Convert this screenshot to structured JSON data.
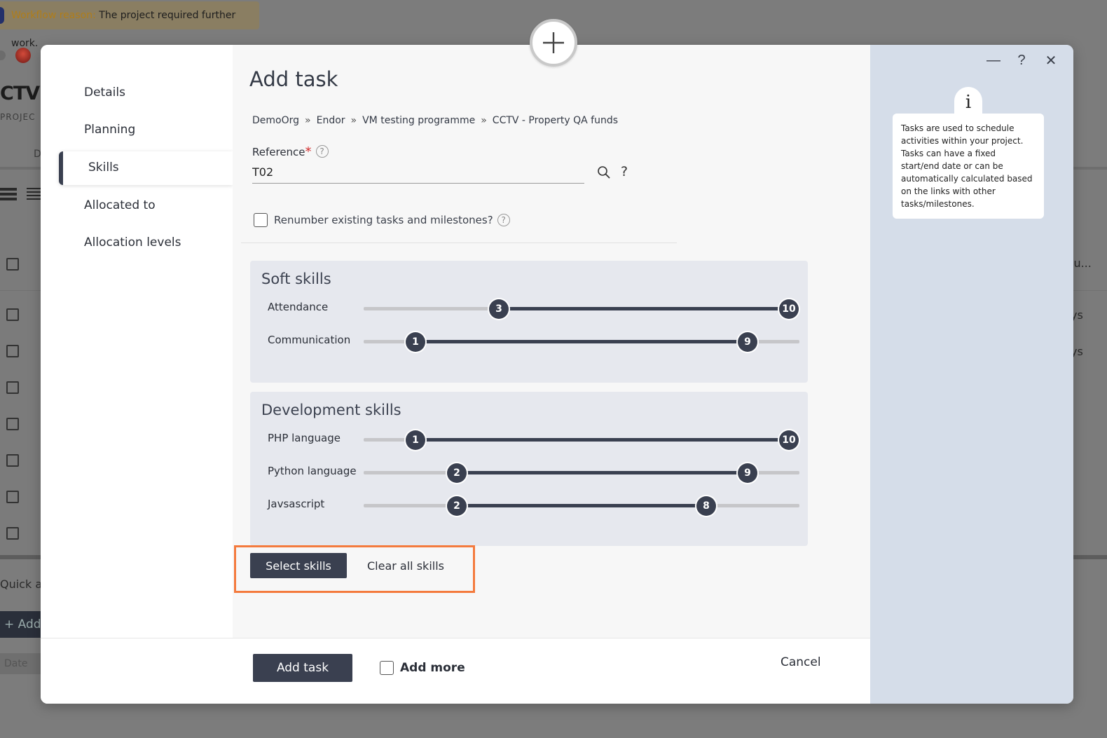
{
  "background": {
    "workflow_label": "Workflow reason:",
    "workflow_text": " The project required further work.",
    "project_title": "CTV",
    "project_sub": "PROJEC",
    "tab_letter": "D",
    "col_header": "lu...",
    "row_suffix_1": "ys",
    "row_suffix_2": "ys",
    "quick_label": "Quick ac",
    "add_label": "Add",
    "date_label": "Date"
  },
  "sidebar": {
    "items": [
      {
        "label": "Details"
      },
      {
        "label": "Planning"
      },
      {
        "label": "Skills"
      },
      {
        "label": "Allocated to"
      },
      {
        "label": "Allocation levels"
      }
    ],
    "active_index": 2
  },
  "form": {
    "title": "Add task",
    "breadcrumb": [
      "DemoOrg",
      "Endor",
      "VM testing programme",
      "CCTV - Property QA funds"
    ],
    "reference_label": "Reference",
    "reference_required": "*",
    "reference_value": "T02",
    "help_glyph": "?",
    "renumber_label": "Renumber existing tasks and milestones?"
  },
  "skill_groups": [
    {
      "title": "Soft skills",
      "skills": [
        {
          "name": "Attendance",
          "min": 3,
          "max": 10
        },
        {
          "name": "Communication",
          "min": 1,
          "max": 9
        }
      ]
    },
    {
      "title": "Development skills",
      "skills": [
        {
          "name": "PHP language",
          "min": 1,
          "max": 10
        },
        {
          "name": "Python language",
          "min": 2,
          "max": 9
        },
        {
          "name": "Javsascript",
          "min": 2,
          "max": 8
        }
      ]
    }
  ],
  "skill_scale": {
    "min": 0,
    "max": 10
  },
  "actions": {
    "select_skills": "Select skills",
    "clear_all_skills": "Clear all skills"
  },
  "footer": {
    "add_task": "Add task",
    "add_more": "Add more",
    "cancel": "Cancel"
  },
  "info": {
    "icon_glyph": "i",
    "text": "Tasks are used to schedule activities within your project. Tasks can have a fixed start/end date or can be automatically calculated based on the links with other tasks/milestones."
  },
  "window": {
    "minimize": "—",
    "help": "?",
    "close": "✕"
  },
  "colors": {
    "accent": "#3a4050",
    "highlight": "#f47a3d",
    "info_panel": "#d5dde9",
    "required": "#d32f2f"
  }
}
